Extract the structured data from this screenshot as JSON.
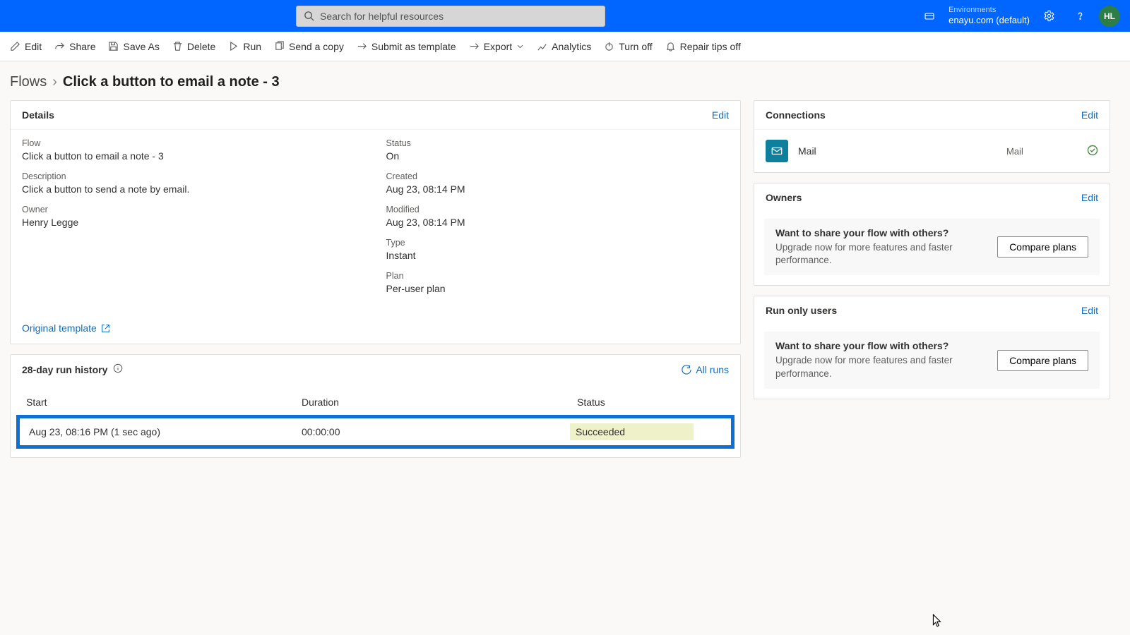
{
  "header": {
    "search_placeholder": "Search for helpful resources",
    "env_label": "Environments",
    "env_name": "enayu.com (default)",
    "avatar_initials": "HL"
  },
  "cmdbar": {
    "edit": "Edit",
    "share": "Share",
    "saveas": "Save As",
    "delete": "Delete",
    "run": "Run",
    "sendcopy": "Send a copy",
    "submit": "Submit as template",
    "export": "Export",
    "analytics": "Analytics",
    "turnoff": "Turn off",
    "repair": "Repair tips off"
  },
  "breadcrumb": {
    "root": "Flows",
    "page": "Click a button to email a note - 3"
  },
  "details": {
    "title": "Details",
    "edit": "Edit",
    "flow_l": "Flow",
    "flow_v": "Click a button to email a note - 3",
    "desc_l": "Description",
    "desc_v": "Click a button to send a note by email.",
    "owner_l": "Owner",
    "owner_v": "Henry Legge",
    "status_l": "Status",
    "status_v": "On",
    "created_l": "Created",
    "created_v": "Aug 23, 08:14 PM",
    "modified_l": "Modified",
    "modified_v": "Aug 23, 08:14 PM",
    "type_l": "Type",
    "type_v": "Instant",
    "plan_l": "Plan",
    "plan_v": "Per-user plan",
    "origin": "Original template"
  },
  "history": {
    "title": "28-day run history",
    "allruns": "All runs",
    "col_start": "Start",
    "col_dur": "Duration",
    "col_status": "Status",
    "row_start": "Aug 23, 08:16 PM (1 sec ago)",
    "row_dur": "00:00:00",
    "row_status": "Succeeded"
  },
  "connections": {
    "title": "Connections",
    "edit": "Edit",
    "name": "Mail",
    "type": "Mail"
  },
  "owners": {
    "title": "Owners",
    "edit": "Edit",
    "promo_t": "Want to share your flow with others?",
    "promo_s": "Upgrade now for more features and faster performance.",
    "btn": "Compare plans"
  },
  "runonly": {
    "title": "Run only users",
    "edit": "Edit",
    "promo_t": "Want to share your flow with others?",
    "promo_s": "Upgrade now for more features and faster performance.",
    "btn": "Compare plans"
  }
}
